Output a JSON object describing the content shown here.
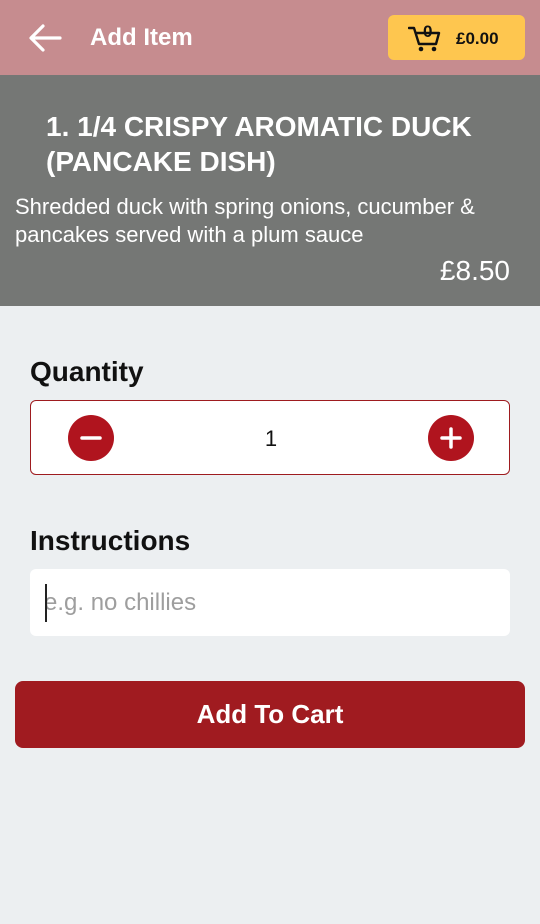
{
  "header": {
    "title": "Add Item",
    "back_icon": "arrow-left-icon",
    "cart": {
      "icon": "shopping-cart-icon",
      "count": "0",
      "total": "£0.00"
    }
  },
  "item": {
    "name": "1. 1/4 CRISPY AROMATIC DUCK (PANCAKE DISH)",
    "description": "Shredded duck with spring onions, cucumber & pancakes served with a plum sauce",
    "price": "£8.50"
  },
  "quantity": {
    "label": "Quantity",
    "value": "1",
    "decrease_icon": "minus-icon",
    "increase_icon": "plus-icon"
  },
  "instructions": {
    "label": "Instructions",
    "value": "",
    "placeholder": "e.g. no chillies"
  },
  "actions": {
    "add_to_cart_label": "Add To Cart"
  },
  "colors": {
    "header_bg": "#c68c8f",
    "cart_pill": "#fec64f",
    "hero_bg": "#757775",
    "accent": "#a01b20",
    "page_bg": "#eceff1"
  }
}
